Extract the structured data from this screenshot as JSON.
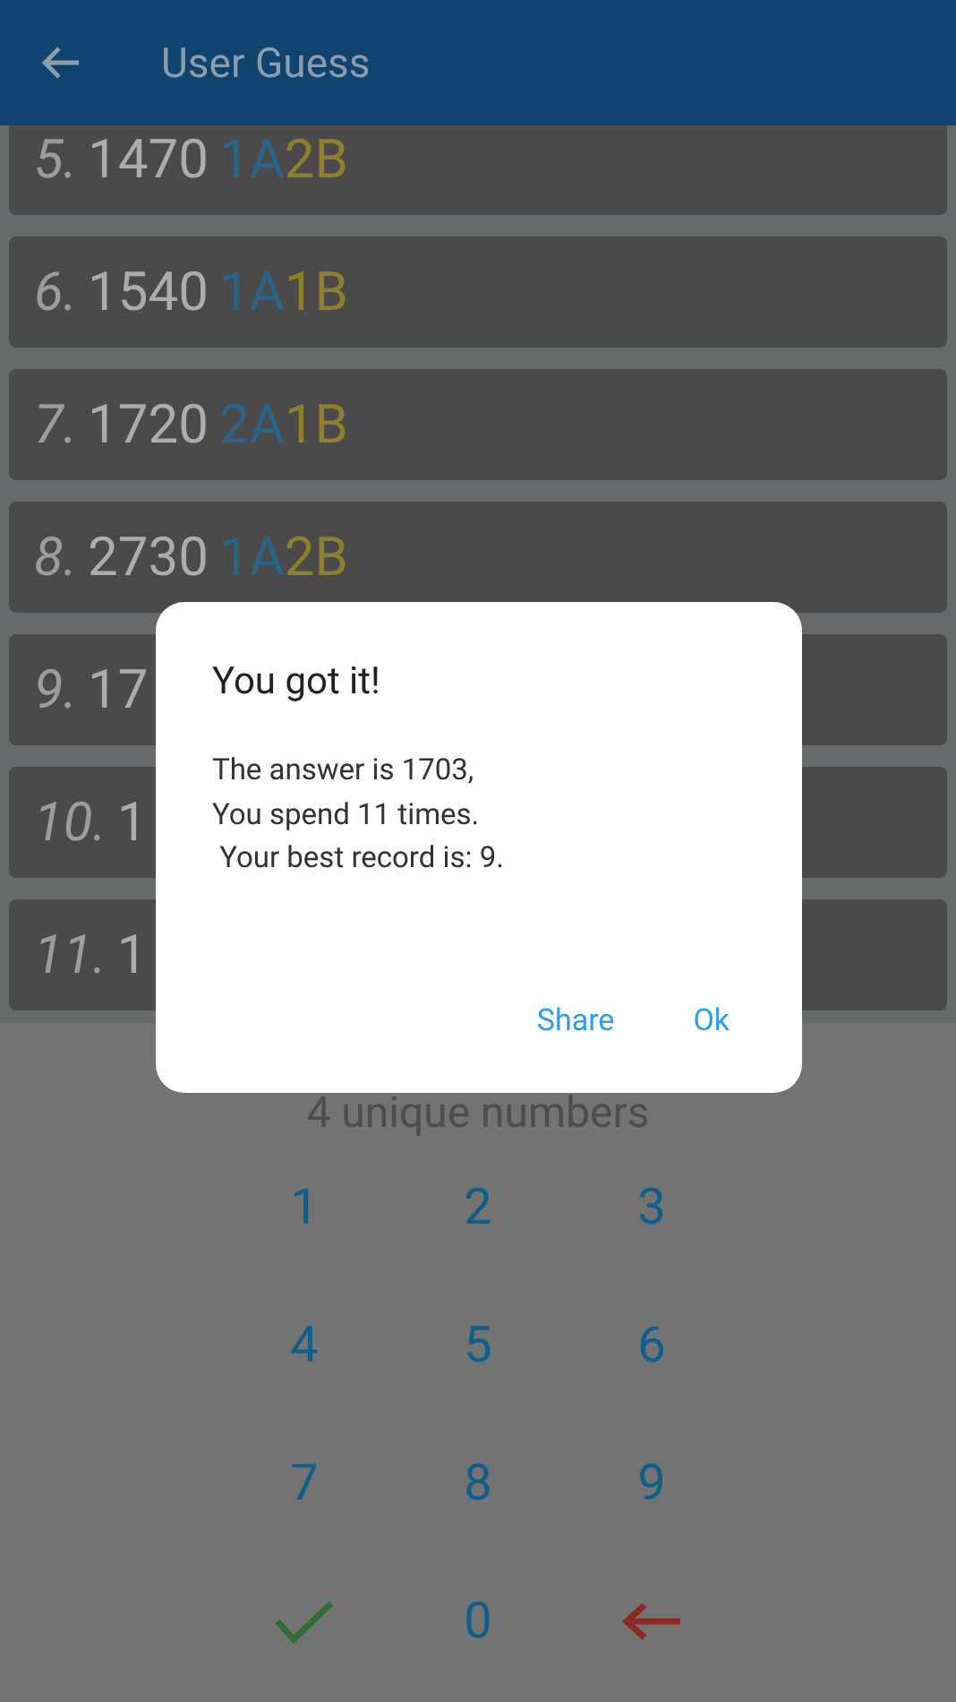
{
  "app_bar": {
    "title": "User Guess"
  },
  "guesses": [
    {
      "index": "5.",
      "guess": "1470",
      "a": "1A",
      "b": "2B"
    },
    {
      "index": "6.",
      "guess": "1540",
      "a": "1A",
      "b": "1B"
    },
    {
      "index": "7.",
      "guess": "1720",
      "a": "2A",
      "b": "1B"
    },
    {
      "index": "8.",
      "guess": "2730",
      "a": "1A",
      "b": "2B"
    },
    {
      "index": "9.",
      "guess": "17"
    },
    {
      "index": "10.",
      "guess": "1"
    },
    {
      "index": "11.",
      "guess": "1"
    }
  ],
  "hint": "4 unique numbers",
  "keypad": [
    {
      "kind": "digit",
      "label": "1"
    },
    {
      "kind": "digit",
      "label": "2"
    },
    {
      "kind": "digit",
      "label": "3"
    },
    {
      "kind": "digit",
      "label": "4"
    },
    {
      "kind": "digit",
      "label": "5"
    },
    {
      "kind": "digit",
      "label": "6"
    },
    {
      "kind": "digit",
      "label": "7"
    },
    {
      "kind": "digit",
      "label": "8"
    },
    {
      "kind": "digit",
      "label": "9"
    },
    {
      "kind": "confirm"
    },
    {
      "kind": "digit",
      "label": "0"
    },
    {
      "kind": "delete"
    }
  ],
  "dialog": {
    "title": "You got it!",
    "message": "The answer is 1703,\nYou spend 11 times.\n Your best record is: 9.",
    "actions": [
      "Share",
      "Ok"
    ]
  }
}
